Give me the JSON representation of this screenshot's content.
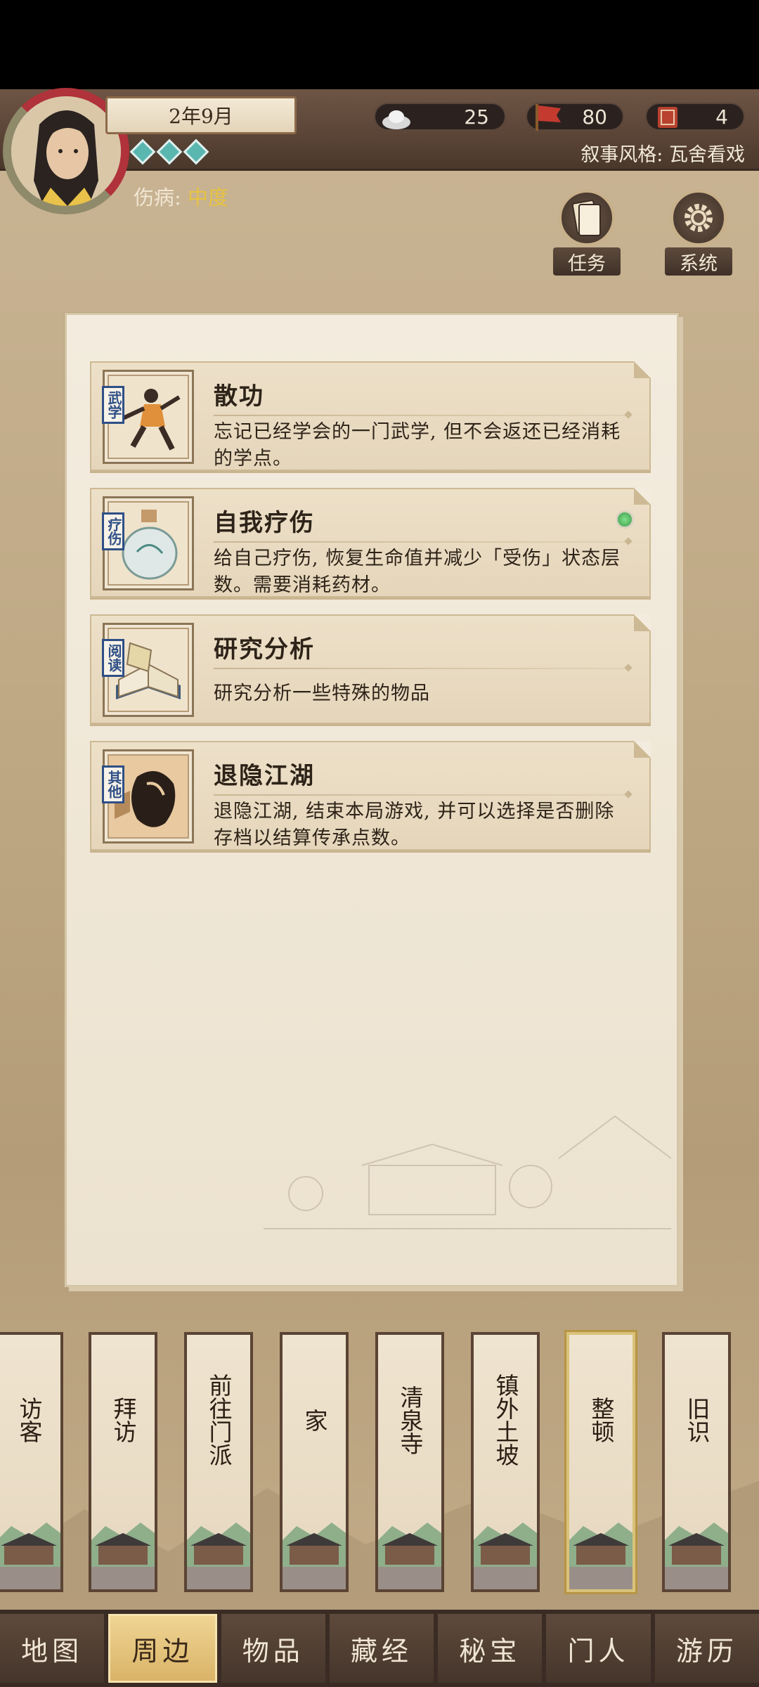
{
  "header": {
    "date": "2年9月",
    "injury_label": "伤病:",
    "injury_level": "中度",
    "silver": "25",
    "reputation": "80",
    "seal": "4",
    "narrative_style": "叙事风格: 瓦舍看戏",
    "quest_label": "任务",
    "system_label": "系统"
  },
  "actions": [
    {
      "tag": "武学",
      "title": "散功",
      "desc": "忘记已经学会的一门武学, 但不会返还已经消耗的学点。",
      "icon": "martial-artist-icon"
    },
    {
      "tag": "疗伤",
      "title": "自我疗伤",
      "desc": "给自己疗伤, 恢复生命值并减少「受伤」状态层数。需要消耗药材。",
      "icon": "medicine-bottle-icon",
      "notify": true
    },
    {
      "tag": "阅读",
      "title": "研究分析",
      "desc": "研究分析一些特殊的物品",
      "icon": "book-icon"
    },
    {
      "tag": "其他",
      "title": "退隐江湖",
      "desc": "退隐江湖, 结束本局游戏, 并可以选择是否删除存档以结算传承点数。",
      "icon": "retire-icon"
    }
  ],
  "locations": [
    "访客",
    "拜访",
    "前往门派",
    "家",
    "清泉寺",
    "镇外土坡",
    "整顿",
    "旧识"
  ],
  "active_location": "整顿",
  "nav": [
    "地图",
    "周边",
    "物品",
    "藏经",
    "秘宝",
    "门人",
    "游历"
  ],
  "active_nav": "周边",
  "colors": {
    "tag_blue": "#2e4f86",
    "injury_yellow": "#e6c340",
    "notify_green": "#4caf50"
  }
}
